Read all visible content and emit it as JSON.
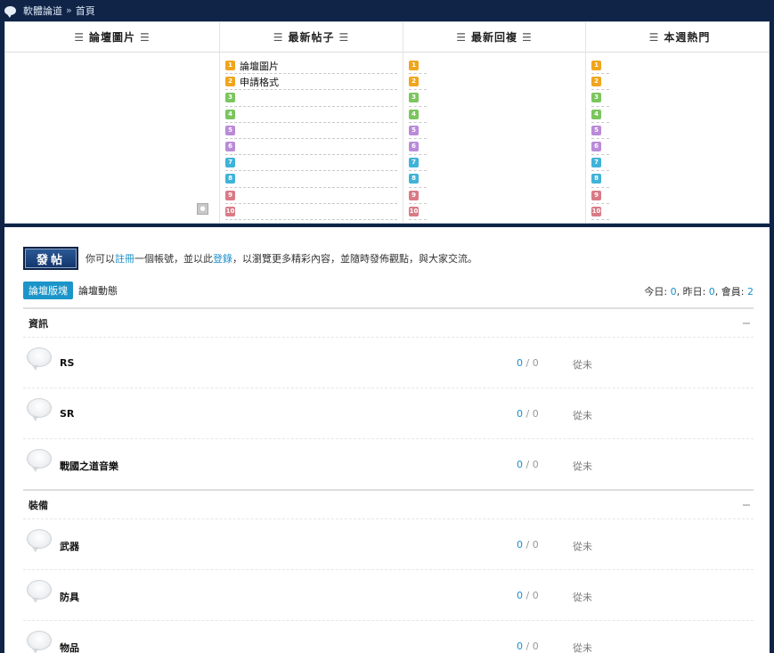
{
  "breadcrumb": {
    "site": "軟體論道",
    "separator": "»",
    "current": "首頁"
  },
  "top_columns": [
    {
      "title": "論壇圖片",
      "items": []
    },
    {
      "title": "最新帖子",
      "items": [
        "論壇圖片",
        "申請格式",
        "",
        "",
        "",
        "",
        "",
        "",
        "",
        ""
      ]
    },
    {
      "title": "最新回複",
      "items": [
        "",
        "",
        "",
        "",
        "",
        "",
        "",
        "",
        "",
        ""
      ]
    },
    {
      "title": "本週熱門",
      "items": [
        "",
        "",
        "",
        "",
        "",
        "",
        "",
        "",
        "",
        ""
      ]
    }
  ],
  "post_bar": {
    "button_label": "發帖",
    "msg_before": "你可以",
    "register_link": "註冊",
    "msg_middle": "一個帳號，並以此",
    "login_link": "登錄",
    "msg_after": "，以瀏覽更多精彩內容，並隨時發佈觀點，與大家交流。"
  },
  "tabs": [
    {
      "label": "論壇版塊",
      "active": true
    },
    {
      "label": "論壇動態",
      "active": false
    }
  ],
  "stats": {
    "today_label": "今日:",
    "today": "0",
    "yesterday_label": ", 昨日:",
    "yesterday": "0",
    "members_label": ", 會員:",
    "members": "2"
  },
  "groups": [
    {
      "title": "資訊",
      "forums": [
        {
          "name": "RS",
          "threads": "0",
          "posts": "0",
          "last": "從未"
        },
        {
          "name": "SR",
          "threads": "0",
          "posts": "0",
          "last": "從未"
        },
        {
          "name": "戰國之道音樂",
          "threads": "0",
          "posts": "0",
          "last": "從未"
        }
      ]
    },
    {
      "title": "裝備",
      "forums": [
        {
          "name": "武器",
          "threads": "0",
          "posts": "0",
          "last": "從未"
        },
        {
          "name": "防具",
          "threads": "0",
          "posts": "0",
          "last": "從未"
        },
        {
          "name": "物品",
          "threads": "0",
          "posts": "0",
          "last": "從未"
        }
      ]
    }
  ],
  "colors": {
    "navy": "#0f2447",
    "accent_blue": "#1b95c9",
    "badge_orange": "#f0a51e",
    "badge_green": "#7cc55e",
    "badge_purple": "#b98bd8",
    "badge_cyan": "#3fb3d8",
    "badge_red": "#d97a86"
  },
  "icons": {
    "breadcrumb": "speech-bubble-icon",
    "forum": "speech-bubble-icon",
    "collapse": "minus-icon",
    "slideshow_nav": "dot-icon"
  }
}
